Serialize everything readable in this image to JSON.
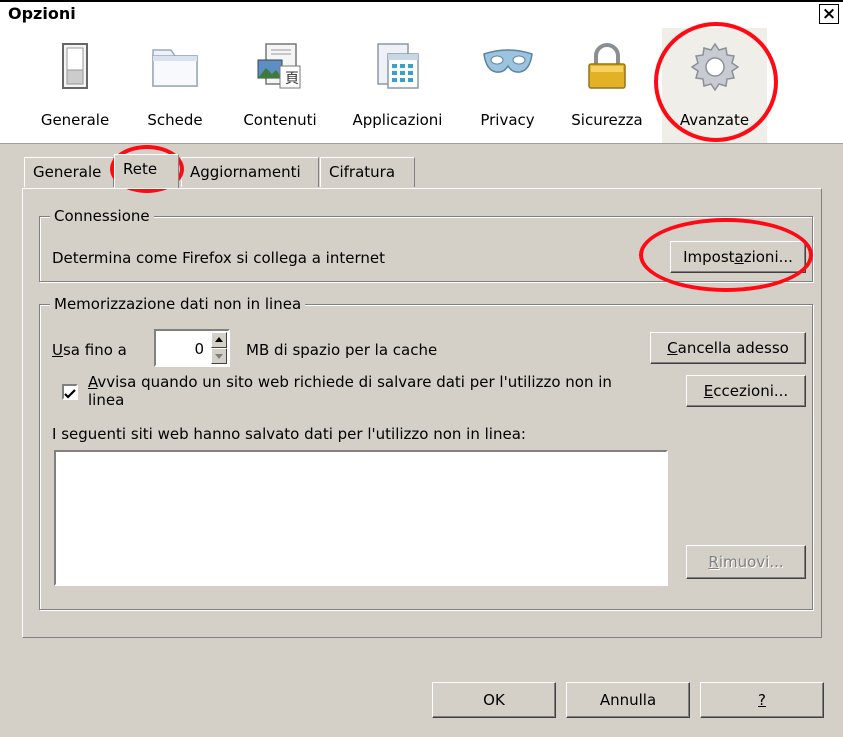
{
  "window": {
    "title": "Opzioni",
    "close": "×"
  },
  "toolbar": {
    "items": [
      {
        "label": "Generale",
        "icon": "switch-icon"
      },
      {
        "label": "Schede",
        "icon": "folder-tabs-icon"
      },
      {
        "label": "Contenuti",
        "icon": "picture-page-icon"
      },
      {
        "label": "Applicazioni",
        "icon": "applications-window-icon"
      },
      {
        "label": "Privacy",
        "icon": "mask-icon"
      },
      {
        "label": "Sicurezza",
        "icon": "padlock-icon"
      },
      {
        "label": "Avanzate",
        "icon": "gear-icon",
        "selected": true
      }
    ]
  },
  "tabs": [
    {
      "label": "Generale"
    },
    {
      "label": "Rete",
      "selected": true
    },
    {
      "label": "Aggiornamenti"
    },
    {
      "label": "Cifratura"
    }
  ],
  "connection": {
    "legend": "Connessione",
    "description": "Determina come Firefox si collega a internet",
    "settings_button": {
      "pre": "Impost",
      "accel": "a",
      "post": "zioni..."
    }
  },
  "offline": {
    "legend": "Memorizzazione dati non in linea",
    "use_up_to": {
      "accel": "U",
      "post": "sa fino a"
    },
    "cache_value": "0",
    "cache_unit": "MB di spazio per la cache",
    "clear_button": {
      "accel": "C",
      "post": "ancella adesso"
    },
    "warn_checkbox": {
      "checked": true,
      "accel": "A",
      "line1": "vvisa quando un sito web richiede di salvare dati per l'utilizzo non in",
      "line2": "linea"
    },
    "exceptions_button": {
      "accel": "E",
      "post": "ccezioni..."
    },
    "sites_label": "I seguenti siti web hanno salvato dati per l'utilizzo non in linea:",
    "sites": [],
    "remove_button": {
      "accel": "R",
      "post": "imuovi...",
      "disabled": true
    }
  },
  "footer": {
    "ok": "OK",
    "cancel": "Annulla",
    "help": "?"
  },
  "colors": {
    "annotation": "#ff0a14",
    "dialog_bg": "#d4d0c8"
  }
}
